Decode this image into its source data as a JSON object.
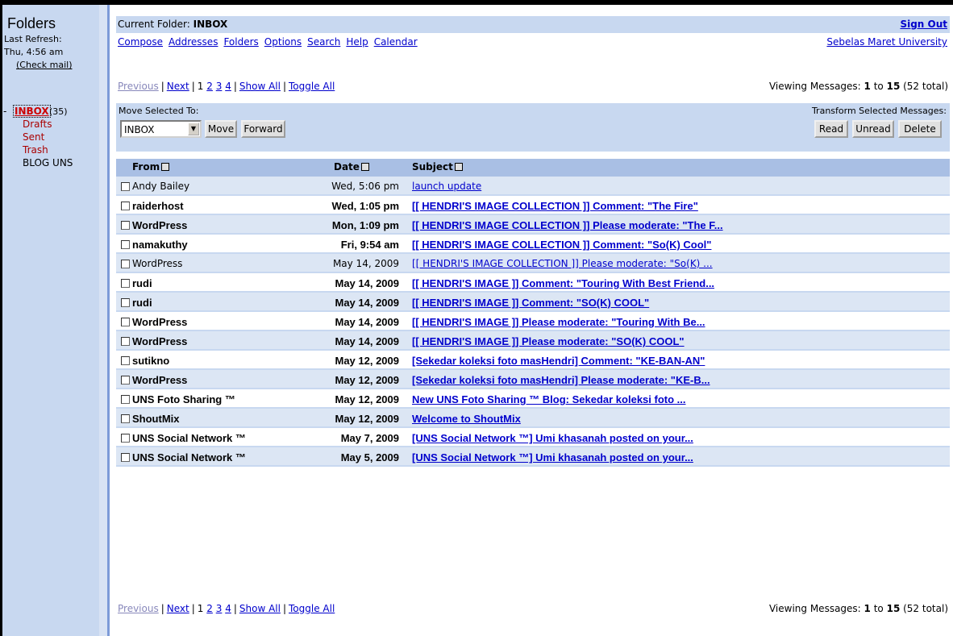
{
  "sidebar": {
    "title": "Folders",
    "last_refresh_label": "Last Refresh:",
    "last_refresh_time": "Thu, 4:56 am",
    "check_mail": "(Check mail)",
    "inbox": {
      "dash": "-",
      "label": "INBOX",
      "count": "(35)"
    },
    "folders": [
      {
        "label": "Drafts"
      },
      {
        "label": "Sent"
      },
      {
        "label": "Trash"
      },
      {
        "label": "BLOG UNS"
      }
    ]
  },
  "header": {
    "current_folder_label": "Current Folder: ",
    "current_folder": "INBOX",
    "sign_out": "Sign Out",
    "nav": [
      "Compose",
      "Addresses",
      "Folders",
      "Options",
      "Search",
      "Help",
      "Calendar"
    ],
    "org": "Sebelas Maret University"
  },
  "paging": {
    "previous": "Previous",
    "next": "Next",
    "current_page": "1",
    "pages": [
      "2",
      "3",
      "4"
    ],
    "show_all": "Show All",
    "toggle_all": "Toggle All",
    "viewing_prefix": "Viewing Messages: ",
    "from": "1",
    "to_word": " to ",
    "to": "15",
    "total": " (52 total)"
  },
  "actions": {
    "move_label": "Move Selected To:",
    "transform_label": "Transform Selected Messages:",
    "select_value": "INBOX",
    "move_button": "Move",
    "forward_button": "Forward",
    "read_button": "Read",
    "unread_button": "Unread",
    "delete_button": "Delete"
  },
  "table": {
    "col_from": "From",
    "col_date": "Date",
    "col_subject": "Subject",
    "rows": [
      {
        "from": "Andy Bailey",
        "date": "Wed, 5:06 pm",
        "subject": "launch update",
        "unread": false
      },
      {
        "from": "raiderhost",
        "date": "Wed, 1:05 pm",
        "subject": "[[ HENDRI'S IMAGE COLLECTION ]] Comment: \"The Fire\"",
        "unread": true
      },
      {
        "from": "WordPress",
        "date": "Mon, 1:09 pm",
        "subject": "[[ HENDRI'S IMAGE COLLECTION ]] Please moderate: \"The F...",
        "unread": true
      },
      {
        "from": "namakuthy",
        "date": "Fri, 9:54 am",
        "subject": "[[ HENDRI'S IMAGE COLLECTION ]] Comment: \"So(K) Cool\"",
        "unread": true
      },
      {
        "from": "WordPress",
        "date": "May 14, 2009",
        "subject": "[[ HENDRI'S IMAGE COLLECTION ]] Please moderate: \"So(K) ...",
        "unread": false
      },
      {
        "from": "rudi",
        "date": "May 14, 2009",
        "subject": "[[ HENDRI'S IMAGE ]] Comment: \"Touring With Best Friend...",
        "unread": true
      },
      {
        "from": "rudi",
        "date": "May 14, 2009",
        "subject": "[[ HENDRI'S IMAGE ]] Comment: \"SO(K) COOL\"",
        "unread": true
      },
      {
        "from": "WordPress",
        "date": "May 14, 2009",
        "subject": "[[ HENDRI'S IMAGE ]] Please moderate: \"Touring With Be...",
        "unread": true
      },
      {
        "from": "WordPress",
        "date": "May 14, 2009",
        "subject": "[[ HENDRI'S IMAGE ]] Please moderate: \"SO(K) COOL\"",
        "unread": true
      },
      {
        "from": "sutikno",
        "date": "May 12, 2009",
        "subject": "[Sekedar koleksi foto masHendri] Comment: \"KE-BAN-AN\"",
        "unread": true
      },
      {
        "from": "WordPress",
        "date": "May 12, 2009",
        "subject": "[Sekedar koleksi foto masHendri] Please moderate: \"KE-B...",
        "unread": true
      },
      {
        "from": "UNS Foto Sharing ™",
        "date": "May 12, 2009",
        "subject": "New UNS Foto Sharing ™ Blog: Sekedar koleksi foto ...",
        "unread": true
      },
      {
        "from": "ShoutMix",
        "date": "May 12, 2009",
        "subject": "Welcome to ShoutMix",
        "unread": true
      },
      {
        "from": "UNS Social Network ™",
        "date": "May 7, 2009",
        "subject": "[UNS Social Network ™] Umi khasanah posted on your...",
        "unread": true
      },
      {
        "from": "UNS Social Network ™",
        "date": "May 5, 2009",
        "subject": "[UNS Social Network ™] Umi khasanah posted on your...",
        "unread": true
      }
    ]
  }
}
